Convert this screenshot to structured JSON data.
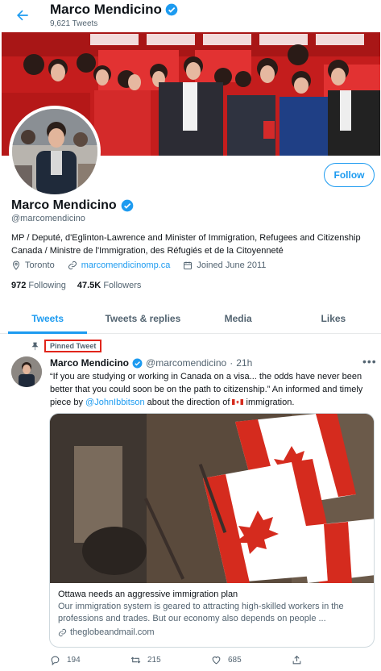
{
  "header": {
    "name": "Marco Mendicino",
    "tweet_count": "9,621 Tweets"
  },
  "profile": {
    "name": "Marco Mendicino",
    "handle": "@marcomendicino",
    "bio": "MP / Deputé, d'Eglinton-Lawrence and Minister of Immigration, Refugees and Citizenship Canada / Ministre de l'Immigration, des Réfugiés et de la Citoyenneté",
    "location": "Toronto",
    "website": "marcomendicinomp.ca",
    "joined": "Joined June 2011",
    "following_count": "972",
    "following_label": "Following",
    "followers_count": "47.5K",
    "followers_label": "Followers",
    "follow_label": "Follow"
  },
  "tabs": [
    {
      "label": "Tweets",
      "active": true
    },
    {
      "label": "Tweets & replies",
      "active": false
    },
    {
      "label": "Media",
      "active": false
    },
    {
      "label": "Likes",
      "active": false
    }
  ],
  "tweet": {
    "pinned_label": "Pinned Tweet",
    "author": "Marco Mendicino",
    "handle": "@marcomendicino",
    "dot": "·",
    "time": "21h",
    "text_1": "“If you are studying or working in Canada on a visa... the odds have never been better that you could soon be on the path to citizenship.” An informed and timely piece by ",
    "mention": "@JohnIbbitson",
    "text_2": " about the direction of ",
    "text_3": " immigration.",
    "card": {
      "title": "Ottawa needs an aggressive immigration plan",
      "description": "Our immigration system is geared to attracting high-skilled workers in the professions and trades. But our economy also depends on people ...",
      "domain": "theglobeandmail.com"
    },
    "replies": "194",
    "retweets": "215",
    "likes": "685"
  },
  "colors": {
    "accent": "#1d9bf0",
    "highlight_box": "#e0251b",
    "muted": "#536471"
  }
}
